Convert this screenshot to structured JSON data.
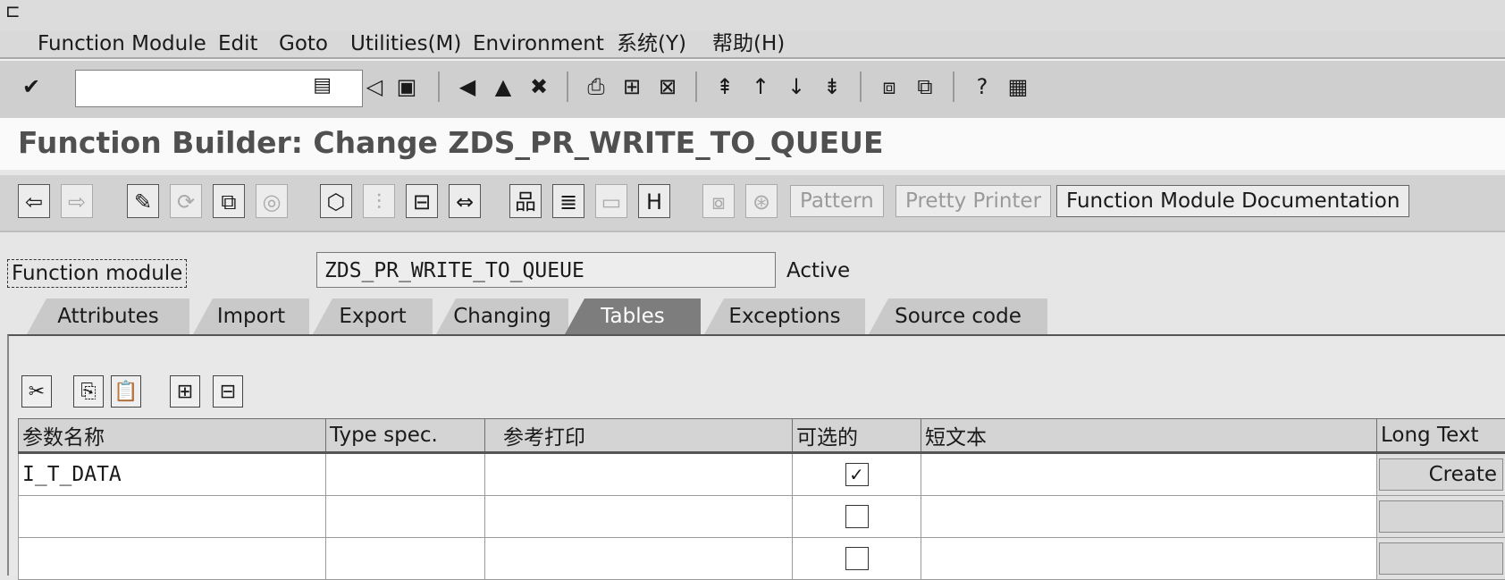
{
  "menu": {
    "items": [
      "Function Module",
      "Edit",
      "Goto",
      "Utilities(M)",
      "Environment",
      "系统(Y)",
      "帮助(H)"
    ]
  },
  "system_toolbar": {
    "command_value": "",
    "icons": [
      "enter-icon",
      "save-icon",
      "back-icon",
      "exit-icon",
      "cancel-icon",
      "print-icon",
      "find-icon",
      "find-next-icon",
      "first-page-icon",
      "previous-page-icon",
      "next-page-icon",
      "last-page-icon",
      "new-session-icon",
      "shortcut-icon",
      "help-icon",
      "layout-menu-icon"
    ]
  },
  "header": {
    "title": "Function Builder: Change ZDS_PR_WRITE_TO_QUEUE"
  },
  "app_toolbar": {
    "pattern_label": "Pattern",
    "pretty_printer_label": "Pretty Printer",
    "documentation_label": "Function Module Documentation"
  },
  "function_module": {
    "label": "Function module",
    "value": "ZDS_PR_WRITE_TO_QUEUE",
    "status": "Active"
  },
  "tabs": [
    {
      "label": "Attributes",
      "active": false
    },
    {
      "label": "Import",
      "active": false
    },
    {
      "label": "Export",
      "active": false
    },
    {
      "label": "Changing",
      "active": false
    },
    {
      "label": "Tables",
      "active": true
    },
    {
      "label": "Exceptions",
      "active": false
    },
    {
      "label": "Source code",
      "active": false
    }
  ],
  "table": {
    "columns": [
      "参数名称",
      "Type spec.",
      "参考打印",
      "可选的",
      "短文本",
      "Long Text"
    ],
    "rows": [
      {
        "name": "I_T_DATA",
        "type_spec": "",
        "reference": "",
        "optional": true,
        "short_text": "",
        "long_text": "Create"
      },
      {
        "name": "",
        "type_spec": "",
        "reference": "",
        "optional": false,
        "short_text": "",
        "long_text": ""
      },
      {
        "name": "",
        "type_spec": "",
        "reference": "",
        "optional": false,
        "short_text": "",
        "long_text": ""
      }
    ],
    "check_mark": "✓"
  }
}
